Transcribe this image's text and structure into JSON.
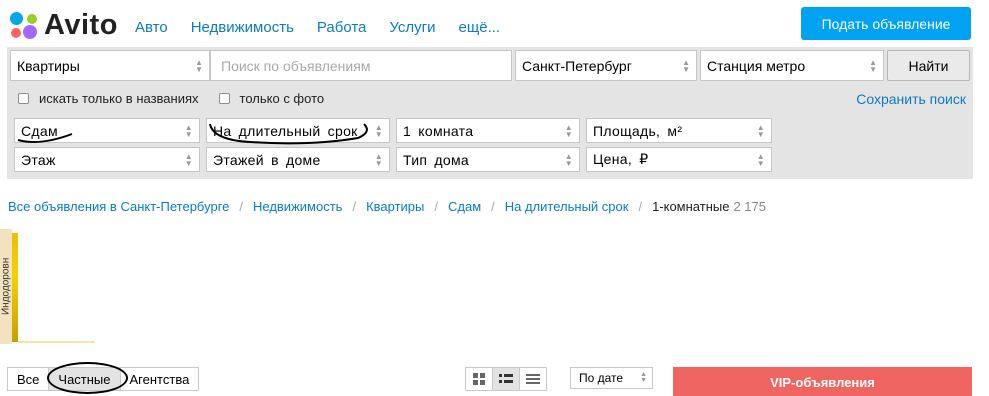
{
  "header": {
    "logo_text": "Avito",
    "nav": [
      "Авто",
      "Недвижимость",
      "Работа",
      "Услуги",
      "ещё..."
    ],
    "post_ad_label": "Подать объявление"
  },
  "search": {
    "category": "Квартиры",
    "query_placeholder": "Поиск по объявлениям",
    "city": "Санкт-Петербург",
    "metro": "Станция метро",
    "find_label": "Найти",
    "only_titles_label": "искать только в названиях",
    "only_photo_label": "только с фото",
    "save_search_label": "Сохранить поиск"
  },
  "filters": {
    "row1": [
      "Сдам",
      "На длительный срок",
      "1 комната",
      "Площадь, м²"
    ],
    "row2": [
      "Этаж",
      "Этажей в доме",
      "Тип дома",
      "Цена, ₽"
    ]
  },
  "breadcrumb": {
    "items": [
      "Все объявления в Санкт-Петербурге",
      "Недвижимость",
      "Квартиры",
      "Сдам",
      "На длительный срок"
    ],
    "current": "1-комнатные",
    "count": "2 175"
  },
  "ad": {
    "vertical_text": "Индодоровн"
  },
  "results": {
    "seller_tabs": [
      "Все",
      "Частные",
      "Агентства"
    ],
    "active_seller_tab": "Частные",
    "sort_label": "По дате",
    "vip_label": "VIP-объявления"
  },
  "colors": {
    "brand_blue": "#02a2f2",
    "link_blue": "#0a7cc6",
    "vip_red": "#ef6561",
    "panel_gray": "#e4e4e4"
  }
}
